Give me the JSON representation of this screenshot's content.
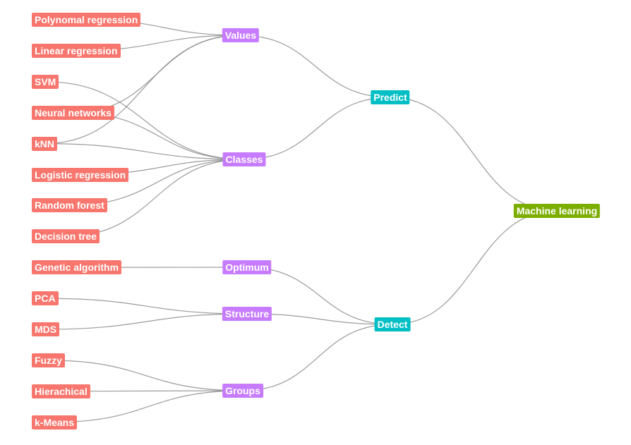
{
  "colors": {
    "leaf": "#F8766D",
    "method": "#C77CFF",
    "task": "#00BFC4",
    "root": "#7CAE00",
    "edge": "#8a8a8a"
  },
  "root": {
    "id": "ml",
    "label": "Machine learning"
  },
  "tasks": [
    {
      "id": "predict",
      "label": "Predict",
      "parent": "ml"
    },
    {
      "id": "detect",
      "label": "Detect",
      "parent": "ml"
    }
  ],
  "methods": [
    {
      "id": "values",
      "label": "Values",
      "parent": "predict"
    },
    {
      "id": "classes",
      "label": "Classes",
      "parent": "predict"
    },
    {
      "id": "optimum",
      "label": "Optimum",
      "parent": "detect"
    },
    {
      "id": "structure",
      "label": "Structure",
      "parent": "detect"
    },
    {
      "id": "groups",
      "label": "Groups",
      "parent": "detect"
    }
  ],
  "leaves": [
    {
      "label": "Polynomal regression",
      "parents": [
        "values"
      ]
    },
    {
      "label": "Linear regression",
      "parents": [
        "values"
      ]
    },
    {
      "label": "SVM",
      "parents": [
        "classes"
      ]
    },
    {
      "label": "Neural networks",
      "parents": [
        "values",
        "classes"
      ]
    },
    {
      "label": "kNN",
      "parents": [
        "values",
        "classes"
      ]
    },
    {
      "label": "Logistic regression",
      "parents": [
        "classes"
      ]
    },
    {
      "label": "Random forest",
      "parents": [
        "classes"
      ]
    },
    {
      "label": "Decision tree",
      "parents": [
        "classes"
      ]
    },
    {
      "label": "Genetic algorithm",
      "parents": [
        "optimum"
      ]
    },
    {
      "label": "PCA",
      "parents": [
        "structure"
      ]
    },
    {
      "label": "MDS",
      "parents": [
        "structure"
      ]
    },
    {
      "label": "Fuzzy",
      "parents": [
        "groups"
      ]
    },
    {
      "label": "Hierachical",
      "parents": [
        "groups"
      ]
    },
    {
      "label": "k-Means",
      "parents": [
        "groups"
      ]
    }
  ]
}
